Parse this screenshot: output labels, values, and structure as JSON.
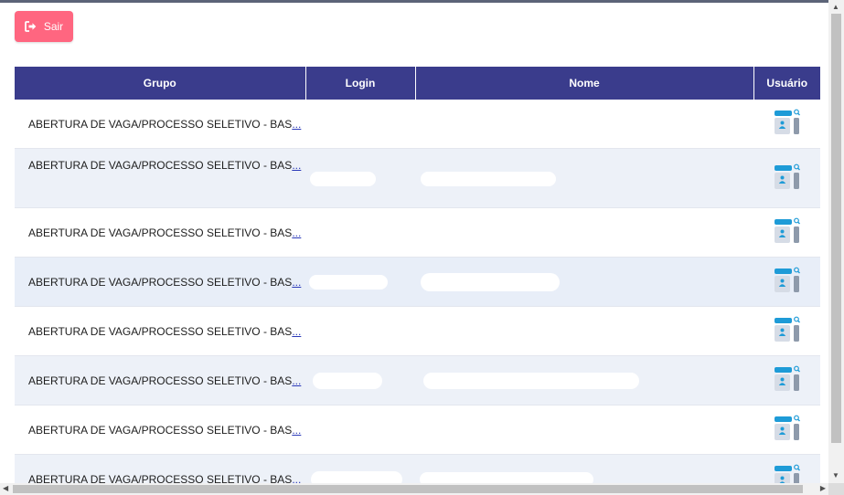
{
  "toolbar": {
    "sair_label": "Sair",
    "sair_icon": "sign-out-icon",
    "sair_color": "#ff6680"
  },
  "table": {
    "header_color": "#3a3c8c",
    "columns": [
      "Grupo",
      "Login",
      "Nome",
      "Usuário"
    ],
    "ellipsis": "...",
    "user_icon": "user-search-icon",
    "rows": [
      {
        "grupo": "ABERTURA DE VAGA/PROCESSO SELETIVO - BAS"
      },
      {
        "grupo": "ABERTURA DE VAGA/PROCESSO SELETIVO - BAS"
      },
      {
        "grupo": "ABERTURA DE VAGA/PROCESSO SELETIVO - BAS"
      },
      {
        "grupo": "ABERTURA DE VAGA/PROCESSO SELETIVO - BAS"
      },
      {
        "grupo": "ABERTURA DE VAGA/PROCESSO SELETIVO - BAS"
      },
      {
        "grupo": "ABERTURA DE VAGA/PROCESSO SELETIVO - BAS"
      },
      {
        "grupo": "ABERTURA DE VAGA/PROCESSO SELETIVO - BAS"
      },
      {
        "grupo": "ABERTURA DE VAGA/PROCESSO SELETIVO - BAS"
      }
    ]
  }
}
